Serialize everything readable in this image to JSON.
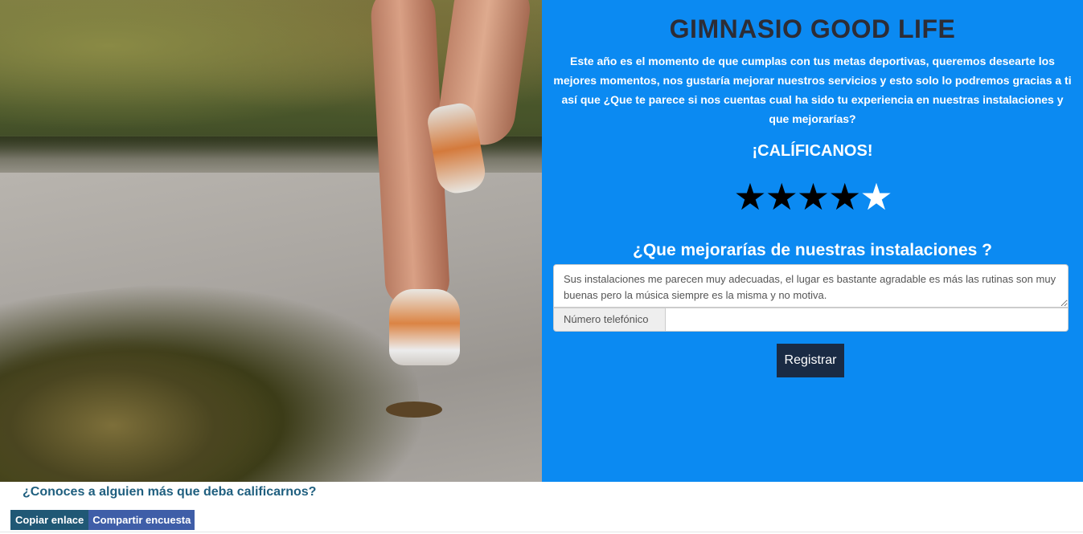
{
  "header": {
    "title": "GIMNASIO GOOD LIFE",
    "intro": "Este año es el momento de que cumplas con tus metas deportivas, queremos desearte los mejores momentos, nos gustaría mejorar nuestros servicios y esto solo lo podremos gracias a ti así que ¿Que te parece si nos cuentas cual ha sido tu experiencia en nuestras instalaciones y que mejorarías?"
  },
  "rating": {
    "title": "¡CALÍFICANOS!",
    "value": 4,
    "max": 5,
    "star_glyph": "★",
    "filled_color": "#000000",
    "empty_color": "#ffffff"
  },
  "form": {
    "question": "¿Que mejorarías de nuestras instalaciones ?",
    "comment_value": "Sus instalaciones me parecen muy adecuadas, el lugar es bastante agradable es más las rutinas son muy buenas pero la música siempre es la misma y no motiva.",
    "phone_label": "Número telefónico",
    "phone_value": "",
    "submit_label": "Registrar"
  },
  "share": {
    "question": "¿Conoces a alguien más que deba calificarnos?",
    "copy_label": "Copiar enlace",
    "share_label": "Compartir encuesta"
  },
  "colors": {
    "panel_bg": "#0b8af2",
    "title_color": "#2d2d36",
    "submit_bg": "#1a2b44",
    "copy_bg": "#205875",
    "share_bg": "#3f5ea8"
  },
  "photo": {
    "subject": "runner-legs-on-road"
  }
}
